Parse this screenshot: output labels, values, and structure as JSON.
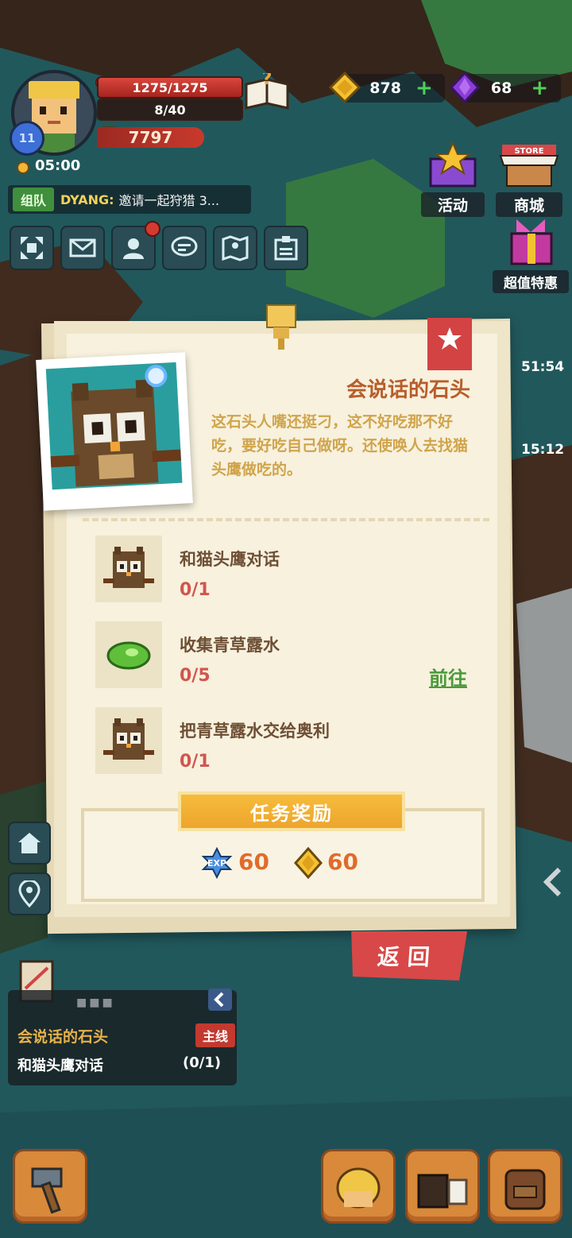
{
  "hud": {
    "level": "11",
    "hp": "1275/1275",
    "energy": "8/40",
    "power": "7797",
    "timer": "05:00",
    "gold": "878",
    "gems": "68"
  },
  "chat": {
    "tag": "组队",
    "name": "DYANG:",
    "text": "邀请一起狩猎 3..."
  },
  "side": {
    "event_label": "活动",
    "shop_label": "商城",
    "shop_sign": "STORE",
    "deal_label": "超值特惠",
    "timer1": "51:54",
    "timer2": "15:12"
  },
  "quest": {
    "title": "会说话的石头",
    "description": "这石头人嘴还挺刁，这不好吃那不好吃，要好吃自己做呀。还使唤人去找猫头鹰做吃的。",
    "tasks": [
      {
        "name": "和猫头鹰对话",
        "progress": "0/1",
        "icon": "owl-icon"
      },
      {
        "name": "收集青草露水",
        "progress": "0/5",
        "icon": "leaf-dew-icon"
      },
      {
        "name": "把青草露水交给奥利",
        "progress": "0/1",
        "icon": "owl-icon"
      }
    ],
    "goto_label": "前往",
    "reward_title": "任务奖励",
    "rewards": {
      "exp_label": "EXP",
      "exp": "60",
      "gold": "60"
    },
    "back_label": "返回"
  },
  "tracker": {
    "title": "会说话的石头",
    "tag": "主线",
    "task": "和猫头鹰对话",
    "progress": "(0/1)"
  },
  "colors": {
    "title": "#b85d2a",
    "description": "#d0a44a",
    "progress": "#d1554f",
    "goto": "#4a9a3a",
    "reward_header": "#eda52c",
    "back_button": "#d84848"
  }
}
